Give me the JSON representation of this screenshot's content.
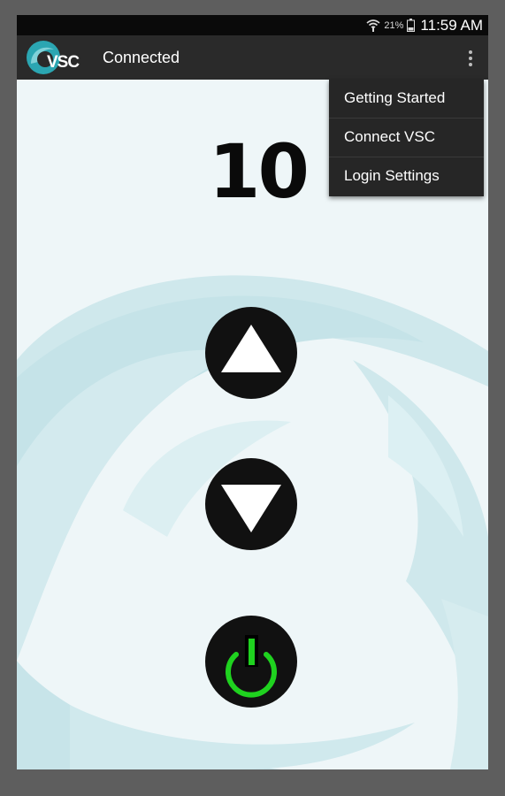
{
  "status_bar": {
    "battery_percent": "21%",
    "time": "11:59 AM",
    "icons": [
      "wifi-icon",
      "battery-icon"
    ]
  },
  "app_bar": {
    "logo_text": "VSC",
    "title": "Connected",
    "overflow_icon": "more-vert-icon"
  },
  "counter": {
    "value": "10"
  },
  "controls": {
    "up_icon": "triangle-up-icon",
    "down_icon": "triangle-down-icon",
    "power_icon": "power-icon"
  },
  "menu": {
    "items": [
      {
        "label": "Getting Started"
      },
      {
        "label": "Connect VSC"
      },
      {
        "label": "Login Settings"
      }
    ]
  },
  "colors": {
    "app_bar": "#2a2a2a",
    "status_bar": "#0a0a0a",
    "background": "#eef6f8",
    "wave": "#c9e6ea",
    "logo_teal": "#2ba6b2",
    "button": "#111111",
    "power_green": "#1fd21f",
    "menu": "#262626"
  }
}
